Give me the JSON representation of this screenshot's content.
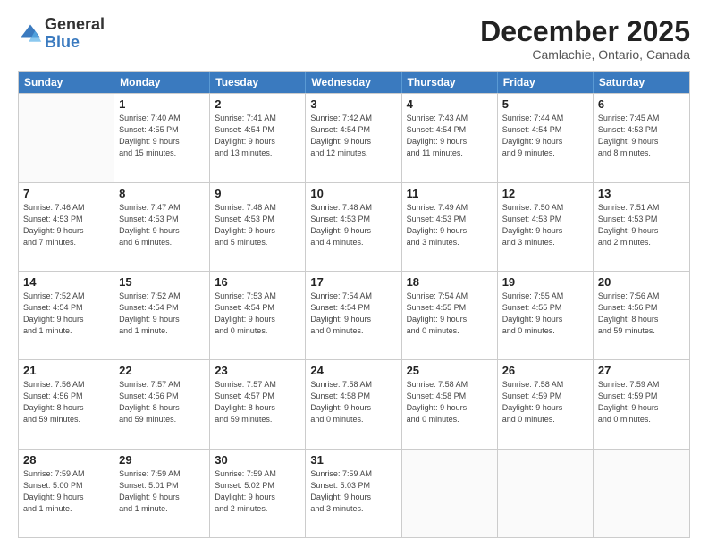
{
  "logo": {
    "general": "General",
    "blue": "Blue"
  },
  "title": "December 2025",
  "subtitle": "Camlachie, Ontario, Canada",
  "headers": [
    "Sunday",
    "Monday",
    "Tuesday",
    "Wednesday",
    "Thursday",
    "Friday",
    "Saturday"
  ],
  "weeks": [
    [
      {
        "day": "",
        "info": ""
      },
      {
        "day": "1",
        "info": "Sunrise: 7:40 AM\nSunset: 4:55 PM\nDaylight: 9 hours\nand 15 minutes."
      },
      {
        "day": "2",
        "info": "Sunrise: 7:41 AM\nSunset: 4:54 PM\nDaylight: 9 hours\nand 13 minutes."
      },
      {
        "day": "3",
        "info": "Sunrise: 7:42 AM\nSunset: 4:54 PM\nDaylight: 9 hours\nand 12 minutes."
      },
      {
        "day": "4",
        "info": "Sunrise: 7:43 AM\nSunset: 4:54 PM\nDaylight: 9 hours\nand 11 minutes."
      },
      {
        "day": "5",
        "info": "Sunrise: 7:44 AM\nSunset: 4:54 PM\nDaylight: 9 hours\nand 9 minutes."
      },
      {
        "day": "6",
        "info": "Sunrise: 7:45 AM\nSunset: 4:53 PM\nDaylight: 9 hours\nand 8 minutes."
      }
    ],
    [
      {
        "day": "7",
        "info": "Sunrise: 7:46 AM\nSunset: 4:53 PM\nDaylight: 9 hours\nand 7 minutes."
      },
      {
        "day": "8",
        "info": "Sunrise: 7:47 AM\nSunset: 4:53 PM\nDaylight: 9 hours\nand 6 minutes."
      },
      {
        "day": "9",
        "info": "Sunrise: 7:48 AM\nSunset: 4:53 PM\nDaylight: 9 hours\nand 5 minutes."
      },
      {
        "day": "10",
        "info": "Sunrise: 7:48 AM\nSunset: 4:53 PM\nDaylight: 9 hours\nand 4 minutes."
      },
      {
        "day": "11",
        "info": "Sunrise: 7:49 AM\nSunset: 4:53 PM\nDaylight: 9 hours\nand 3 minutes."
      },
      {
        "day": "12",
        "info": "Sunrise: 7:50 AM\nSunset: 4:53 PM\nDaylight: 9 hours\nand 3 minutes."
      },
      {
        "day": "13",
        "info": "Sunrise: 7:51 AM\nSunset: 4:53 PM\nDaylight: 9 hours\nand 2 minutes."
      }
    ],
    [
      {
        "day": "14",
        "info": "Sunrise: 7:52 AM\nSunset: 4:54 PM\nDaylight: 9 hours\nand 1 minute."
      },
      {
        "day": "15",
        "info": "Sunrise: 7:52 AM\nSunset: 4:54 PM\nDaylight: 9 hours\nand 1 minute."
      },
      {
        "day": "16",
        "info": "Sunrise: 7:53 AM\nSunset: 4:54 PM\nDaylight: 9 hours\nand 0 minutes."
      },
      {
        "day": "17",
        "info": "Sunrise: 7:54 AM\nSunset: 4:54 PM\nDaylight: 9 hours\nand 0 minutes."
      },
      {
        "day": "18",
        "info": "Sunrise: 7:54 AM\nSunset: 4:55 PM\nDaylight: 9 hours\nand 0 minutes."
      },
      {
        "day": "19",
        "info": "Sunrise: 7:55 AM\nSunset: 4:55 PM\nDaylight: 9 hours\nand 0 minutes."
      },
      {
        "day": "20",
        "info": "Sunrise: 7:56 AM\nSunset: 4:56 PM\nDaylight: 8 hours\nand 59 minutes."
      }
    ],
    [
      {
        "day": "21",
        "info": "Sunrise: 7:56 AM\nSunset: 4:56 PM\nDaylight: 8 hours\nand 59 minutes."
      },
      {
        "day": "22",
        "info": "Sunrise: 7:57 AM\nSunset: 4:56 PM\nDaylight: 8 hours\nand 59 minutes."
      },
      {
        "day": "23",
        "info": "Sunrise: 7:57 AM\nSunset: 4:57 PM\nDaylight: 8 hours\nand 59 minutes."
      },
      {
        "day": "24",
        "info": "Sunrise: 7:58 AM\nSunset: 4:58 PM\nDaylight: 9 hours\nand 0 minutes."
      },
      {
        "day": "25",
        "info": "Sunrise: 7:58 AM\nSunset: 4:58 PM\nDaylight: 9 hours\nand 0 minutes."
      },
      {
        "day": "26",
        "info": "Sunrise: 7:58 AM\nSunset: 4:59 PM\nDaylight: 9 hours\nand 0 minutes."
      },
      {
        "day": "27",
        "info": "Sunrise: 7:59 AM\nSunset: 4:59 PM\nDaylight: 9 hours\nand 0 minutes."
      }
    ],
    [
      {
        "day": "28",
        "info": "Sunrise: 7:59 AM\nSunset: 5:00 PM\nDaylight: 9 hours\nand 1 minute."
      },
      {
        "day": "29",
        "info": "Sunrise: 7:59 AM\nSunset: 5:01 PM\nDaylight: 9 hours\nand 1 minute."
      },
      {
        "day": "30",
        "info": "Sunrise: 7:59 AM\nSunset: 5:02 PM\nDaylight: 9 hours\nand 2 minutes."
      },
      {
        "day": "31",
        "info": "Sunrise: 7:59 AM\nSunset: 5:03 PM\nDaylight: 9 hours\nand 3 minutes."
      },
      {
        "day": "",
        "info": ""
      },
      {
        "day": "",
        "info": ""
      },
      {
        "day": "",
        "info": ""
      }
    ]
  ]
}
